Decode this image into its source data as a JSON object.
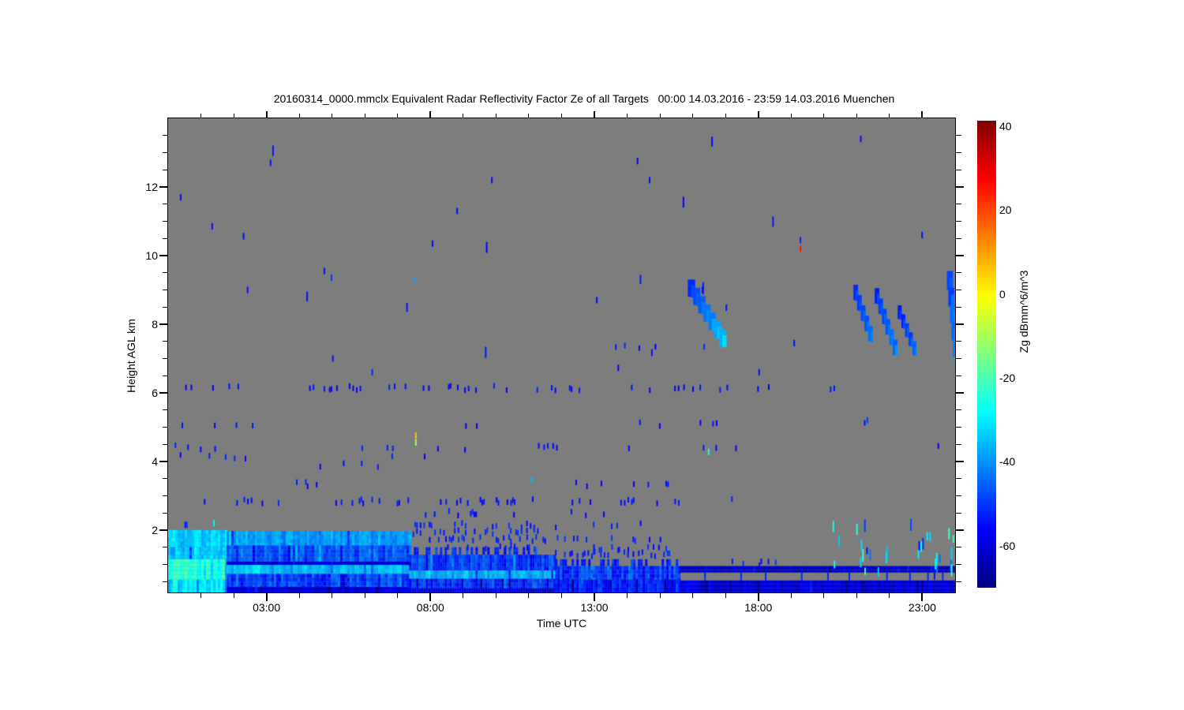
{
  "title": {
    "text": "20160314_0000.mmclx Equivalent Radar Reflectivity Factor Ze of all Targets   00:00 14.03.2016 - 23:59 14.03.2016 Muenchen"
  },
  "chart_data": {
    "type": "heatmap",
    "title": "20160314_0000.mmclx Equivalent Radar Reflectivity Factor Ze of all Targets",
    "time_range": "00:00 14.03.2016 - 23:59 14.03.2016",
    "site": "Muenchen",
    "xlabel": "Time UTC",
    "ylabel": "Height AGL km",
    "x_range_hours": [
      0,
      24
    ],
    "x_major_ticks": [
      {
        "hour": 3,
        "label": "03:00"
      },
      {
        "hour": 8,
        "label": "08:00"
      },
      {
        "hour": 13,
        "label": "13:00"
      },
      {
        "hour": 18,
        "label": "18:00"
      },
      {
        "hour": 23,
        "label": "23:00"
      }
    ],
    "x_minor_step_hours": 1,
    "y_range_km": [
      0.18,
      14.0
    ],
    "y_major_ticks": [
      2,
      4,
      6,
      8,
      10,
      12
    ],
    "y_minor_step_km": 0.5,
    "background_color": "#7d7d7d",
    "colorbar": {
      "label": "Zg dBmm^6/m^3",
      "range": [
        -70,
        41.3
      ],
      "ticks": [
        40,
        20,
        0,
        -20,
        -40,
        -60
      ],
      "colormap": "jet"
    },
    "seed": 42,
    "features": {
      "blocks": [
        {
          "t": [
            0,
            1.78
          ],
          "layers": [
            {
              "km": [
                1.5,
                2.0
              ],
              "v": -33,
              "amp": 4
            },
            {
              "km": [
                1.15,
                1.5
              ],
              "v": -35,
              "amp": 5
            },
            {
              "km": [
                0.55,
                1.15
              ],
              "v": -24,
              "amp": 5
            },
            {
              "km": [
                0.18,
                0.55
              ],
              "v": -31,
              "amp": 5
            }
          ]
        },
        {
          "t": [
            1.78,
            7.35
          ],
          "layers": [
            {
              "km": [
                1.55,
                1.97
              ],
              "v": -39,
              "amp": 4
            },
            {
              "km": [
                1.08,
                1.55
              ],
              "v": -47,
              "amp": 5
            },
            {
              "km": [
                0.98,
                1.08
              ],
              "v": -60,
              "amp": 3
            },
            {
              "km": [
                0.72,
                0.98
              ],
              "v": -36,
              "amp": 3
            },
            {
              "km": [
                0.34,
                0.72
              ],
              "v": -49,
              "amp": 6
            },
            {
              "km": [
                0.18,
                0.34
              ],
              "v": -60,
              "amp": 3
            }
          ]
        },
        {
          "t": [
            7.35,
            11.8
          ],
          "layers": [
            {
              "km": [
                1.28,
                1.5
              ],
              "v": -52,
              "amp": 4,
              "p": 0.5
            },
            {
              "km": [
                0.82,
                1.28
              ],
              "v": -49,
              "amp": 5
            },
            {
              "km": [
                0.58,
                0.82
              ],
              "v": -38,
              "amp": 4
            },
            {
              "km": [
                0.3,
                0.58
              ],
              "v": -51,
              "amp": 5
            },
            {
              "km": [
                0.18,
                0.3
              ],
              "v": -59,
              "amp": 3
            }
          ]
        },
        {
          "t": [
            11.8,
            15.6
          ],
          "layers": [
            {
              "km": [
                0.95,
                1.15
              ],
              "v": -53,
              "amp": 4,
              "p": 0.5
            },
            {
              "km": [
                0.55,
                0.95
              ],
              "v": -50,
              "amp": 6
            },
            {
              "km": [
                0.18,
                0.55
              ],
              "v": -54,
              "amp": 5
            }
          ]
        },
        {
          "t": [
            15.6,
            24.0
          ],
          "layers": [
            {
              "km": [
                0.76,
                0.95
              ],
              "v": -62,
              "amp": 2.5
            },
            {
              "km": [
                0.18,
                0.53
              ],
              "v": -60,
              "amp": 3
            }
          ]
        }
      ],
      "streaks": [
        {
          "t0": 15.85,
          "km0": 9.3,
          "t1": 16.8,
          "km1": 7.85,
          "steps": 7,
          "v0": -52,
          "v1": -36,
          "w": 0.22,
          "h": 0.5
        },
        {
          "t0": 20.9,
          "km0": 9.15,
          "t1": 21.35,
          "km1": 7.95,
          "steps": 5,
          "v0": -52,
          "v1": -46,
          "w": 0.14,
          "h": 0.45
        },
        {
          "t0": 21.55,
          "km0": 9.05,
          "t1": 22.1,
          "km1": 7.55,
          "steps": 6,
          "v0": -52,
          "v1": -44,
          "w": 0.14,
          "h": 0.45
        },
        {
          "t0": 22.25,
          "km0": 8.55,
          "t1": 22.7,
          "km1": 7.5,
          "steps": 5,
          "v0": -53,
          "v1": -47,
          "w": 0.12,
          "h": 0.4
        },
        {
          "t0": 23.75,
          "km0": 9.55,
          "t1": 23.98,
          "km1": 7.1,
          "steps": 6,
          "v0": -50,
          "v1": -40,
          "w": 0.18,
          "h": 0.55
        }
      ],
      "speck_rows": [
        {
          "km": 7.35,
          "ranges": [
            [
              12.2,
              16.6,
              0.05
            ],
            [
              19.0,
              19.3,
              0.04
            ]
          ]
        },
        {
          "km": 6.15,
          "ranges": [
            [
              0.3,
              2.6,
              0.12
            ],
            [
              2.6,
              4.3,
              0.07
            ],
            [
              4.3,
              9.2,
              0.2
            ],
            [
              9.2,
              12.3,
              0.1
            ],
            [
              12.3,
              17.2,
              0.09
            ],
            [
              17.8,
              18.6,
              0.05
            ],
            [
              19.3,
              20.3,
              0.06
            ]
          ]
        },
        {
          "km": 5.1,
          "ranges": [
            [
              0.3,
              2.9,
              0.07
            ],
            [
              7.3,
              9.5,
              0.09
            ],
            [
              14.2,
              15.4,
              0.07
            ],
            [
              16.1,
              17.4,
              0.06
            ],
            [
              21.0,
              21.6,
              0.04
            ]
          ]
        },
        {
          "km": 4.42,
          "ranges": [
            [
              0.2,
              3.1,
              0.11
            ],
            [
              5.4,
              9.6,
              0.1
            ],
            [
              10.4,
              14.1,
              0.08
            ],
            [
              15.7,
              17.6,
              0.07
            ],
            [
              20.0,
              23.6,
              0.04
            ]
          ]
        },
        {
          "km": 4.15,
          "ranges": [
            [
              0.3,
              2.6,
              0.09
            ],
            [
              6.7,
              8.7,
              0.1
            ],
            [
              12.5,
              13.4,
              0.06
            ]
          ]
        },
        {
          "km": 3.9,
          "ranges": [
            [
              0.6,
              7.4,
              0.05
            ],
            [
              16.3,
              16.9,
              0.05
            ]
          ]
        },
        {
          "km": 3.35,
          "ranges": [
            [
              3.9,
              4.7,
              0.1
            ],
            [
              11.1,
              15.4,
              0.09
            ],
            [
              16.0,
              16.7,
              0.06
            ]
          ]
        },
        {
          "km": 2.85,
          "ranges": [
            [
              0.1,
              5.1,
              0.13
            ],
            [
              5.1,
              10.6,
              0.2
            ],
            [
              10.6,
              15.6,
              0.13
            ],
            [
              16.4,
              17.4,
              0.07
            ],
            [
              18.9,
              19.2,
              0.05
            ]
          ]
        },
        {
          "km": 2.5,
          "ranges": [
            [
              7.5,
              10.9,
              0.11
            ],
            [
              12.0,
              13.6,
              0.07
            ],
            [
              19.9,
              20.2,
              0.05
            ]
          ]
        },
        {
          "km": 2.15,
          "v": -53,
          "ranges": [
            [
              7.4,
              11.8,
              0.2
            ],
            [
              12.9,
              14.6,
              0.09
            ],
            [
              18.9,
              19.1,
              0.05
            ]
          ]
        },
        {
          "km": 1.95,
          "v": -53,
          "ranges": [
            [
              7.4,
              11.3,
              0.3
            ]
          ]
        },
        {
          "km": 1.75,
          "v": -53,
          "ranges": [
            [
              7.9,
              11.6,
              0.25
            ],
            [
              11.8,
              15.6,
              0.18
            ]
          ]
        },
        {
          "km": 1.5,
          "v": -53,
          "ranges": [
            [
              8.4,
              15.6,
              0.16
            ]
          ]
        },
        {
          "km": 1.45,
          "v": -53,
          "ranges": [
            [
              12.6,
              14.2,
              0.2
            ]
          ]
        },
        {
          "km": 1.3,
          "v": -53,
          "ranges": [
            [
              11.8,
              15.3,
              0.3
            ],
            [
              16.0,
              19.5,
              0.04
            ]
          ]
        },
        {
          "km": 1.05,
          "v": -53,
          "ranges": [
            [
              15.7,
              19.5,
              0.06
            ]
          ]
        }
      ],
      "scatter_regions": [
        {
          "t": [
            19.8,
            24.0
          ],
          "km": [
            0.9,
            2.35
          ],
          "n": 26,
          "values": [
            -55,
            -50,
            -44,
            -33,
            -26,
            -22
          ]
        },
        {
          "t": [
            22.8,
            24.0
          ],
          "km": [
            1.0,
            2.0
          ],
          "n": 6,
          "values": [
            -30,
            -24
          ]
        },
        {
          "t": [
            0.3,
            19.0
          ],
          "km": [
            6.5,
            13.5
          ],
          "n": 14,
          "values": [
            -55
          ]
        }
      ],
      "cross_dashes": [
        {
          "t": 16.35,
          "km": [
            0.53,
            0.76
          ],
          "v": -52
        },
        {
          "t": 17.45,
          "km": [
            0.53,
            0.76
          ],
          "v": -52
        },
        {
          "t": 18.2,
          "km": [
            0.53,
            0.76
          ],
          "v": -52
        },
        {
          "t": 19.3,
          "km": [
            0.53,
            0.76
          ],
          "v": -52
        },
        {
          "t": 20.1,
          "km": [
            0.53,
            0.76
          ],
          "v": -52
        },
        {
          "t": 20.75,
          "km": [
            0.53,
            0.76
          ],
          "v": -52
        },
        {
          "t": 21.9,
          "km": [
            0.53,
            0.76
          ],
          "v": -52
        },
        {
          "t": 22.6,
          "km": [
            0.53,
            0.76
          ],
          "v": -52
        },
        {
          "t": 23.15,
          "km": [
            0.53,
            0.76
          ],
          "v": -52
        },
        {
          "t": 23.6,
          "km": [
            0.53,
            0.76
          ],
          "v": -52
        }
      ],
      "notable_specks": [
        {
          "t": 0.36,
          "km": 11.7,
          "v": -55
        },
        {
          "t": 0.5,
          "km": 2.15,
          "v": -55
        },
        {
          "t": 0.55,
          "km": 2.15,
          "v": -50
        },
        {
          "t": 1.32,
          "km": 10.85,
          "v": -55
        },
        {
          "t": 1.37,
          "km": 2.2,
          "v": -28
        },
        {
          "t": 2.4,
          "km": 9.0,
          "v": -55
        },
        {
          "t": 3.1,
          "km": 12.7,
          "v": -55
        },
        {
          "t": 4.74,
          "km": 9.55,
          "v": -55
        },
        {
          "t": 4.96,
          "km": 9.35,
          "v": -50
        },
        {
          "t": 5.0,
          "km": 7.0,
          "v": -55
        },
        {
          "t": 6.2,
          "km": 6.6,
          "v": -52
        },
        {
          "t": 7.5,
          "km": 9.3,
          "v": -38
        },
        {
          "t": 7.53,
          "km": 4.75,
          "v": 5
        },
        {
          "t": 7.53,
          "km": 4.55,
          "v": -10
        },
        {
          "t": 8.04,
          "km": 10.35,
          "v": -55
        },
        {
          "t": 8.79,
          "km": 11.3,
          "v": -55
        },
        {
          "t": 9.85,
          "km": 12.2,
          "v": -55
        },
        {
          "t": 11.07,
          "km": 3.45,
          "v": -36
        },
        {
          "t": 13.05,
          "km": 8.7,
          "v": -55
        },
        {
          "t": 14.66,
          "km": 12.2,
          "v": -55
        },
        {
          "t": 16.27,
          "km": 9.0,
          "v": -55
        },
        {
          "t": 16.46,
          "km": 4.28,
          "v": -25
        },
        {
          "t": 17.0,
          "km": 8.48,
          "v": -55
        },
        {
          "t": 18.0,
          "km": 6.6,
          "v": -55
        },
        {
          "t": 19.07,
          "km": 7.45,
          "v": -55
        },
        {
          "t": 19.26,
          "km": 10.45,
          "v": -52
        },
        {
          "t": 19.26,
          "km": 10.2,
          "v": 25
        },
        {
          "t": 21.1,
          "km": 13.4,
          "v": -55
        },
        {
          "t": 21.3,
          "km": 5.2,
          "v": -50
        },
        {
          "t": 22.97,
          "km": 10.6,
          "v": -55
        }
      ]
    }
  }
}
